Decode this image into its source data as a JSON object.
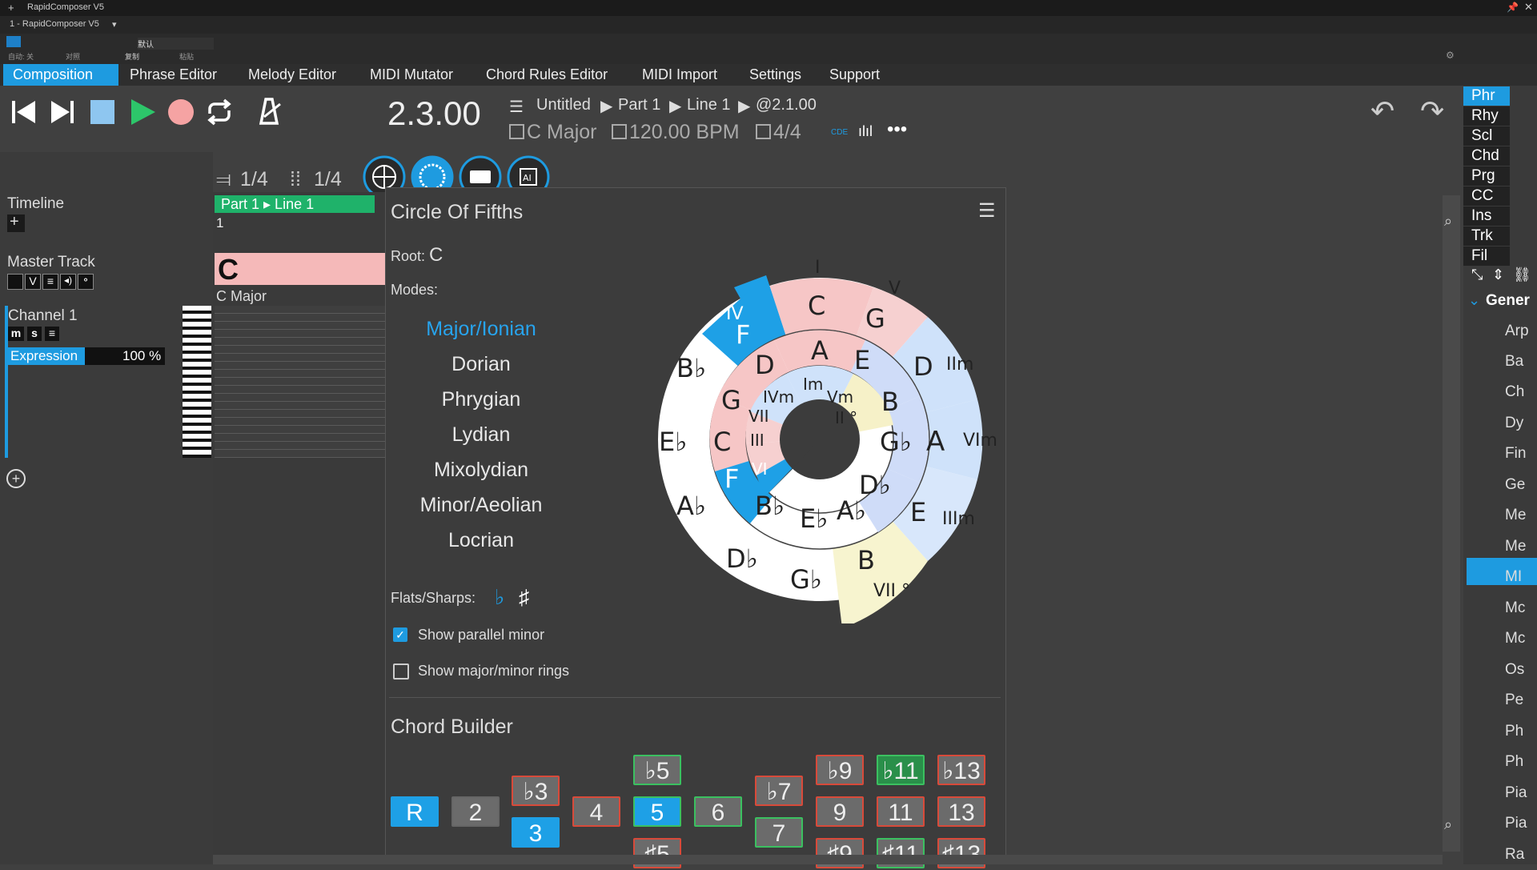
{
  "host": {
    "app_title": "RapidComposer V5",
    "instance": "1 - RapidComposer V5",
    "preset": "默认",
    "auto_label": "自动: 关",
    "compare_label": "对照",
    "copy_label": "复制",
    "paste_label": "粘贴"
  },
  "menu": [
    {
      "label": "Composition",
      "active": true
    },
    {
      "label": "Phrase Editor"
    },
    {
      "label": "Melody Editor"
    },
    {
      "label": "MIDI Mutator"
    },
    {
      "label": "Chord Rules Editor"
    },
    {
      "label": "MIDI Import"
    },
    {
      "label": "Settings"
    },
    {
      "label": "Support"
    }
  ],
  "transport": {
    "position": "2.3.00",
    "song": "Untitled",
    "part": "Part 1",
    "line": "Line 1",
    "at": "@2.1.00",
    "key": "C Major",
    "tempo": "120.00 BPM",
    "meter": "4/4",
    "grid_a": "1/4",
    "grid_b": "1/4",
    "cde": "CDE",
    "more": "•••"
  },
  "left": {
    "timeline": "Timeline",
    "master_track": "Master Track",
    "channel": "Channel 1",
    "expression": "Expression",
    "expression_value": "100 %",
    "master_btns": [
      "V"
    ],
    "channel_btns": [
      "m",
      "s"
    ]
  },
  "track": {
    "part_label": "Part 1 ▸ Line 1",
    "bar_number": "1",
    "chord_symbol": "C",
    "chord_name": "C Major"
  },
  "popup": {
    "title": "Circle Of Fifths",
    "root_label": "Root:",
    "root_value": "C",
    "modes_label": "Modes:",
    "modes": [
      "Major/Ionian",
      "Dorian",
      "Phrygian",
      "Lydian",
      "Mixolydian",
      "Minor/Aeolian",
      "Locrian"
    ],
    "selected_mode": "Major/Ionian",
    "flats_sharps_label": "Flats/Sharps:",
    "flat_symbol": "♭",
    "sharp_symbol": "♯",
    "show_parallel_minor": {
      "label": "Show parallel minor",
      "checked": true
    },
    "show_rings": {
      "label": "Show major/minor rings",
      "checked": false
    },
    "chord_builder_title": "Chord Builder",
    "circle": {
      "outer_notes": [
        "C",
        "G",
        "D",
        "A",
        "E",
        "B",
        "G♭",
        "D♭",
        "A♭",
        "E♭",
        "B♭",
        "F"
      ],
      "inner_notes": [
        "A",
        "E",
        "B",
        "G♭",
        "D♭",
        "A♭",
        "E♭",
        "B♭",
        "F",
        "C",
        "G",
        "D"
      ],
      "outer_degrees": {
        "I": "I",
        "V": "V",
        "IIm": "IIm",
        "VIm": "VIm",
        "IIIm": "IIIm",
        "VII": "VII °",
        "IV": "IV"
      },
      "inner_degrees": {
        "Im": "Im",
        "Vm": "Vm",
        "II": "II °",
        "VI": "VI",
        "III": "III",
        "VII": "VII",
        "IVm": "IVm"
      }
    },
    "intervals": {
      "R": "R",
      "2": "2",
      "b3": "♭3",
      "3": "3",
      "4": "4",
      "b5": "♭5",
      "5": "5",
      "s5": "♯5",
      "6": "6",
      "b7": "♭7",
      "7": "7",
      "b9": "♭9",
      "9": "9",
      "s9": "♯9",
      "b11": "♭11",
      "11": "11",
      "s11": "♯11",
      "b13": "♭13",
      "13": "13",
      "s13": "♯13"
    }
  },
  "right": {
    "tabs": [
      "Phr",
      "Rhy",
      "Scl",
      "Chd",
      "Prg",
      "CC",
      "Ins",
      "Trk",
      "Fil"
    ],
    "active_tab": "Phr",
    "group": "Gener",
    "list": [
      "Arp",
      "Ba",
      "Ch",
      "Dy",
      "Fin",
      "Ge",
      "Me",
      "Me",
      "MI",
      "Mc",
      "Mc",
      "Os",
      "Pe",
      "Ph",
      "Ph",
      "Pia",
      "Pia",
      "Ra"
    ],
    "selected_index": 5
  }
}
